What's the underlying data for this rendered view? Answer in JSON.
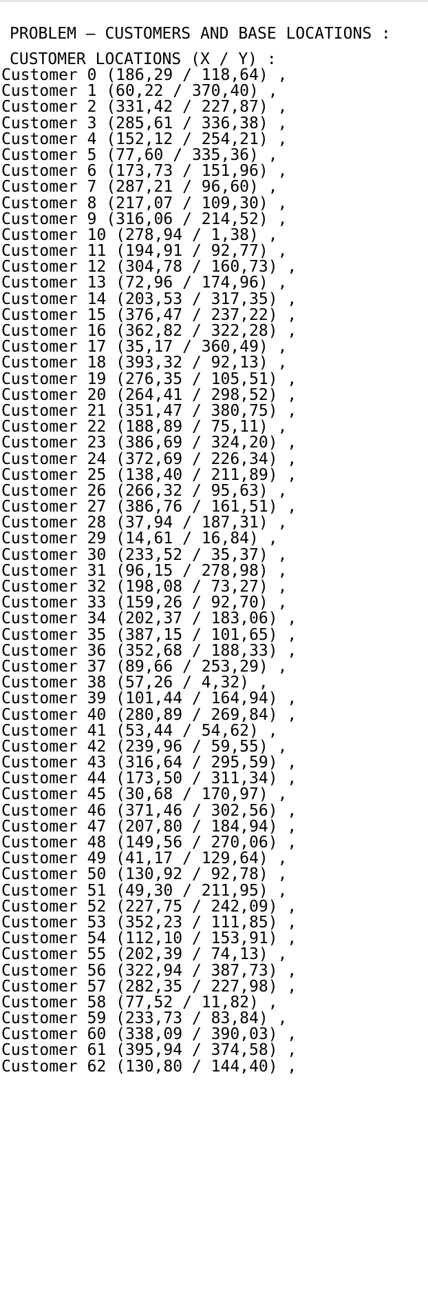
{
  "title": "PROBLEM – CUSTOMERS AND BASE LOCATIONS :",
  "subtitle": "CUSTOMER LOCATIONS (X / Y) :",
  "customers": [
    "Customer 0 (186,29 / 118,64) ,",
    "Customer 1 (60,22 / 370,40) ,",
    "Customer 2 (331,42 / 227,87) ,",
    "Customer 3 (285,61 / 336,38) ,",
    "Customer 4 (152,12 / 254,21) ,",
    "Customer 5 (77,60 / 335,36) ,",
    "Customer 6 (173,73 / 151,96) ,",
    "Customer 7 (287,21 / 96,60) ,",
    "Customer 8 (217,07 / 109,30) ,",
    "Customer 9 (316,06 / 214,52) ,",
    "Customer 10 (278,94 / 1,38) ,",
    "Customer 11 (194,91 / 92,77) ,",
    "Customer 12 (304,78 / 160,73) ,",
    "Customer 13 (72,96 / 174,96) ,",
    "Customer 14 (203,53 / 317,35) ,",
    "Customer 15 (376,47 / 237,22) ,",
    "Customer 16 (362,82 / 322,28) ,",
    "Customer 17 (35,17 / 360,49) ,",
    "Customer 18 (393,32 / 92,13) ,",
    "Customer 19 (276,35 / 105,51) ,",
    "Customer 20 (264,41 / 298,52) ,",
    "Customer 21 (351,47 / 380,75) ,",
    "Customer 22 (188,89 / 75,11) ,",
    "Customer 23 (386,69 / 324,20) ,",
    "Customer 24 (372,69 / 226,34) ,",
    "Customer 25 (138,40 / 211,89) ,",
    "Customer 26 (266,32 / 95,63) ,",
    "Customer 27 (386,76 / 161,51) ,",
    "Customer 28 (37,94 / 187,31) ,",
    "Customer 29 (14,61 / 16,84) ,",
    "Customer 30 (233,52 / 35,37) ,",
    "Customer 31 (96,15 / 278,98) ,",
    "Customer 32 (198,08 / 73,27) ,",
    "Customer 33 (159,26 / 92,70) ,",
    "Customer 34 (202,37 / 183,06) ,",
    "Customer 35 (387,15 / 101,65) ,",
    "Customer 36 (352,68 / 188,33) ,",
    "Customer 37 (89,66 / 253,29) ,",
    "Customer 38 (57,26 / 4,32) ,",
    "Customer 39 (101,44 / 164,94) ,",
    "Customer 40 (280,89 / 269,84) ,",
    "Customer 41 (53,44 / 54,62) ,",
    "Customer 42 (239,96 / 59,55) ,",
    "Customer 43 (316,64 / 295,59) ,",
    "Customer 44 (173,50 / 311,34) ,",
    "Customer 45 (30,68 / 170,97) ,",
    "Customer 46 (371,46 / 302,56) ,",
    "Customer 47 (207,80 / 184,94) ,",
    "Customer 48 (149,56 / 270,06) ,",
    "Customer 49 (41,17 / 129,64) ,",
    "Customer 50 (130,92 / 92,78) ,",
    "Customer 51 (49,30 / 211,95) ,",
    "Customer 52 (227,75 / 242,09) ,",
    "Customer 53 (352,23 / 111,85) ,",
    "Customer 54 (112,10 / 153,91) ,",
    "Customer 55 (202,39 / 74,13) ,",
    "Customer 56 (322,94 / 387,73) ,",
    "Customer 57 (282,35 / 227,98) ,",
    "Customer 58 (77,52 / 11,82) ,",
    "Customer 59 (233,73 / 83,84) ,",
    "Customer 60 (338,09 / 390,03) ,",
    "Customer 61 (395,94 / 374,58) ,",
    "Customer 62 (130,80 / 144,40) ,"
  ]
}
